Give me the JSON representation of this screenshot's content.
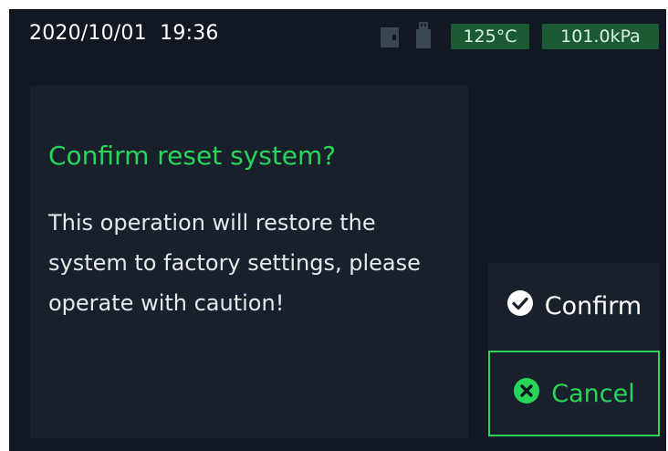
{
  "status_bar": {
    "datetime": "2020/10/01  19:36",
    "sd_icon": "sd-card-icon",
    "usb_icon": "usb-icon",
    "temperature": "125°C",
    "pressure": "101.0kPa"
  },
  "dialog": {
    "title": "Confirm reset system?",
    "message": "This operation will restore the system to factory settings, please operate with caution!",
    "confirm_label": "Confirm",
    "confirm_icon": "check-circle-icon",
    "cancel_label": "Cancel",
    "cancel_icon": "x-circle-icon"
  },
  "colors": {
    "background": "#111822",
    "panel": "#18212b",
    "accent_green": "#28d45a",
    "badge_bg": "#1b5a34"
  }
}
